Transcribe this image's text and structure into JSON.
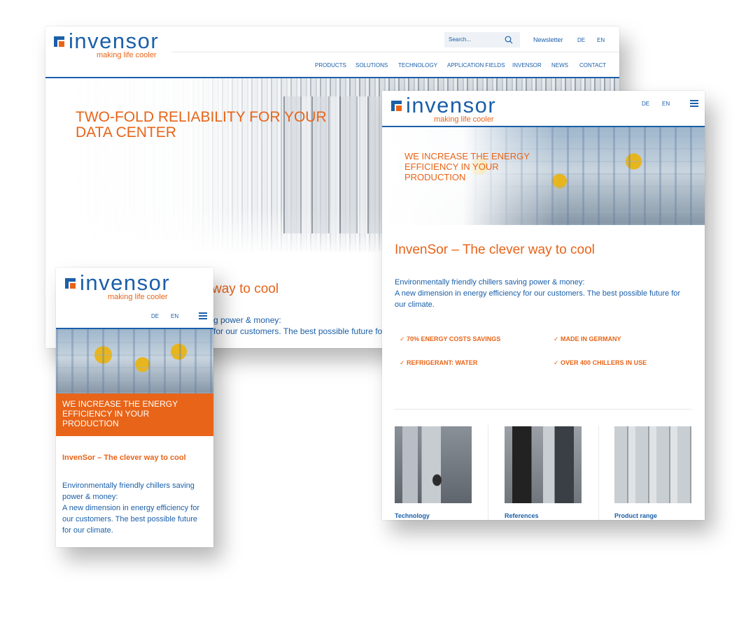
{
  "brand": {
    "name": "invensor",
    "tagline": "making life cooler",
    "colors": {
      "blue": "#1a5fa8",
      "orange": "#e86418"
    }
  },
  "desktop": {
    "search_placeholder": "Search...",
    "newsletter": "Newsletter",
    "lang_de": "DE",
    "lang_en": "EN",
    "nav": [
      "PRODUCTS",
      "SOLUTIONS",
      "TECHNOLOGY",
      "APPLICATION FIELDS",
      "INVENSOR",
      "NEWS",
      "CONTACT"
    ],
    "hero_line1": "TWO-FOLD RELIABILITY FOR YOUR",
    "hero_line2": "DATA CENTER",
    "headline_fragment": "way to cool",
    "text_fragment1": "g power & money:",
    "text_fragment2": "for our customers. The best possible future for c"
  },
  "tablet": {
    "lang_de": "DE",
    "lang_en": "EN",
    "hero": [
      "WE INCREASE THE ENERGY",
      "EFFICIENCY IN YOUR",
      "PRODUCTION"
    ],
    "headline": "InvenSor – The clever way to cool",
    "intro_line1": "Environmentally friendly chillers saving power & money:",
    "intro_line2": "A new dimension in energy efficiency for our customers. The best possible future for",
    "intro_line3": "our climate.",
    "features": [
      "✓ 70% ENERGY COSTS SAVINGS",
      "✓ MADE IN GERMANY",
      "✓ REFRIGERANT: WATER",
      "✓ OVER 400 CHILLERS IN USE"
    ],
    "tiles": [
      "Technology",
      "References",
      "Product range"
    ]
  },
  "mobile": {
    "lang_de": "DE",
    "lang_en": "EN",
    "hero": [
      "WE INCREASE THE ENERGY",
      "EFFICIENCY IN YOUR",
      "PRODUCTION"
    ],
    "headline": "InvenSor – The clever way to cool",
    "body": [
      "Environmentally friendly chillers saving",
      "power & money:",
      "A new dimension in energy efficiency for",
      "our customers. The best possible future",
      "for our climate."
    ]
  }
}
